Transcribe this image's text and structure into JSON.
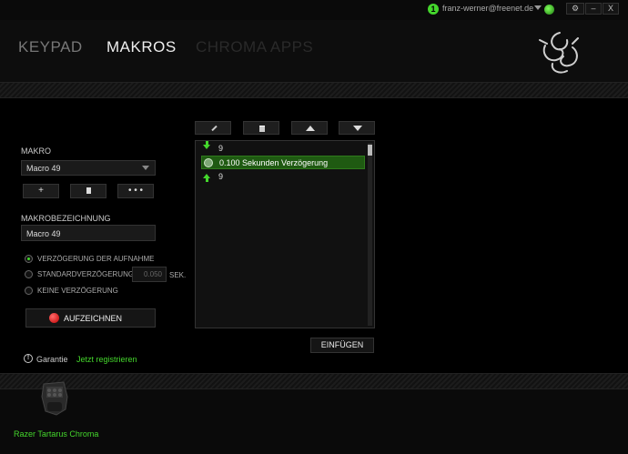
{
  "topbar": {
    "account_badge": "1",
    "account_email": "franz-werner@freenet.de",
    "buttons": {
      "settings": "⚙",
      "minimize": "–",
      "close": "X"
    }
  },
  "tabs": [
    {
      "label": "KEYPAD",
      "active": false
    },
    {
      "label": "MAKROS",
      "active": true
    },
    {
      "label": "CHROMA APPS",
      "active": false
    }
  ],
  "left_panel": {
    "makro_label": "MAKRO",
    "makro_selected": "Macro 49",
    "buttons": {
      "add": "+",
      "delete": "🗑",
      "more": "• • •"
    },
    "bezeichnung_label": "MAKROBEZEICHNUNG",
    "bezeichnung_value": "Macro 49",
    "delay_options": [
      {
        "label": "VERZöGERUNG DER AUFNAHME",
        "selected": true
      },
      {
        "label": "STANDARDVERZöGERUNG",
        "selected": false
      },
      {
        "label": "KEINE VERZöGERUNG",
        "selected": false
      }
    ],
    "standard_delay_value": "0.050",
    "standard_delay_unit": "SEK.",
    "record_label": "AUFZEICHNEN",
    "warranty_label": "Garantie",
    "register_link": "Jetzt registrieren"
  },
  "macro_editor": {
    "toolbar": [
      "edit-icon",
      "trash-icon",
      "move-up-icon",
      "move-down-icon"
    ],
    "steps": [
      {
        "type": "key-down",
        "text": "9",
        "selected": false
      },
      {
        "type": "delay",
        "text": "0.100 Sekunden Verzögerung",
        "selected": true
      },
      {
        "type": "key-up",
        "text": "9",
        "selected": false
      }
    ],
    "insert_label": "EINFüGEN"
  },
  "footer": {
    "device_name": "Razer Tartarus Chroma"
  },
  "colors": {
    "accent": "#44d62c",
    "background": "#000000",
    "record": "#d40000"
  }
}
